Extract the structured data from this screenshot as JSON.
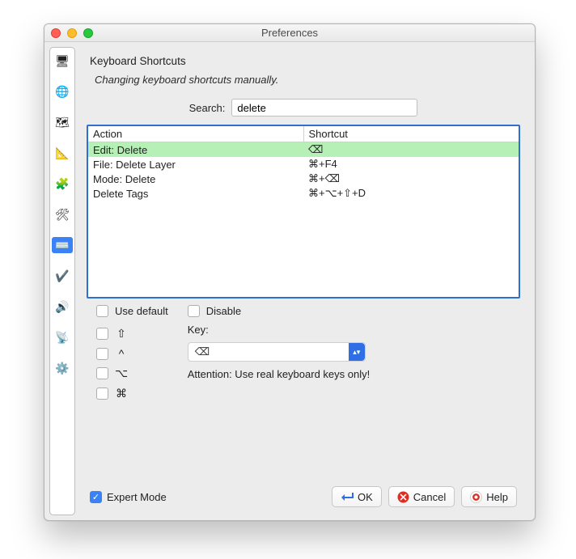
{
  "window": {
    "title": "Preferences"
  },
  "sidebar": {
    "items": [
      {
        "name": "tab-display",
        "glyph": "🖥",
        "selected": false
      },
      {
        "name": "tab-connection",
        "glyph": "🌐",
        "selected": false
      },
      {
        "name": "tab-map",
        "glyph": "🗺",
        "selected": false
      },
      {
        "name": "tab-projection",
        "glyph": "📐",
        "selected": false
      },
      {
        "name": "tab-plugins",
        "glyph": "🧩",
        "selected": false
      },
      {
        "name": "tab-toolbar",
        "glyph": "🛠",
        "selected": false
      },
      {
        "name": "tab-shortcuts",
        "glyph": "⌨️",
        "selected": true
      },
      {
        "name": "tab-validator",
        "glyph": "✔️",
        "selected": false
      },
      {
        "name": "tab-audio",
        "glyph": "🔊",
        "selected": false
      },
      {
        "name": "tab-remote",
        "glyph": "📡",
        "selected": false
      },
      {
        "name": "tab-advanced",
        "glyph": "⚙️",
        "selected": false
      }
    ]
  },
  "panel": {
    "title": "Keyboard Shortcuts",
    "description": "Changing keyboard shortcuts manually.",
    "search_label": "Search:",
    "search_value": "delete",
    "columns": {
      "action": "Action",
      "shortcut": "Shortcut"
    },
    "rows": [
      {
        "action": "Edit: Delete",
        "shortcut": "⌫",
        "selected": true
      },
      {
        "action": "File: Delete Layer",
        "shortcut": "⌘+F4",
        "selected": false
      },
      {
        "action": "Mode: Delete",
        "shortcut": "⌘+⌫",
        "selected": false
      },
      {
        "action": "Delete Tags",
        "shortcut": "⌘+⌥+⇧+D",
        "selected": false
      }
    ],
    "use_default_label": "Use default",
    "use_default_checked": false,
    "disable_label": "Disable",
    "disable_checked": false,
    "modifiers": [
      {
        "name": "shift",
        "symbol": "⇧",
        "checked": false
      },
      {
        "name": "ctrl",
        "symbol": "^",
        "checked": false
      },
      {
        "name": "alt",
        "symbol": "⌥",
        "checked": false
      },
      {
        "name": "cmd",
        "symbol": "⌘",
        "checked": false
      }
    ],
    "key_label": "Key:",
    "key_value": "⌫",
    "attention": "Attention: Use real keyboard keys only!"
  },
  "footer": {
    "expert_mode_label": "Expert Mode",
    "expert_mode_checked": true,
    "ok": "OK",
    "cancel": "Cancel",
    "help": "Help"
  }
}
